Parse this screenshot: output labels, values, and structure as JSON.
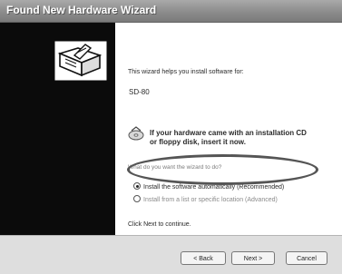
{
  "window": {
    "title": "Found New Hardware Wizard"
  },
  "content": {
    "intro": "This wizard helps you install software for:",
    "device": "SD-80",
    "cd_message_line1": "If your hardware came with an installation CD",
    "cd_message_line2": "or floppy disk, insert it now.",
    "question": "What do you want the wizard to do?",
    "options": [
      {
        "label": "Install the software automatically (Recommended)",
        "selected": true
      },
      {
        "label": "Install from a list or specific location (Advanced)",
        "selected": false
      }
    ],
    "continue": "Click Next to continue."
  },
  "buttons": {
    "back": "< Back",
    "next": "Next >",
    "cancel": "Cancel"
  },
  "icons": {
    "wizard": "hardware-wizard-icon",
    "cd": "cd-disc-icon"
  },
  "colors": {
    "sidebar": "#0b0b0b",
    "titlebar": "#8c8c8c",
    "bottom_bar": "#dedede"
  }
}
